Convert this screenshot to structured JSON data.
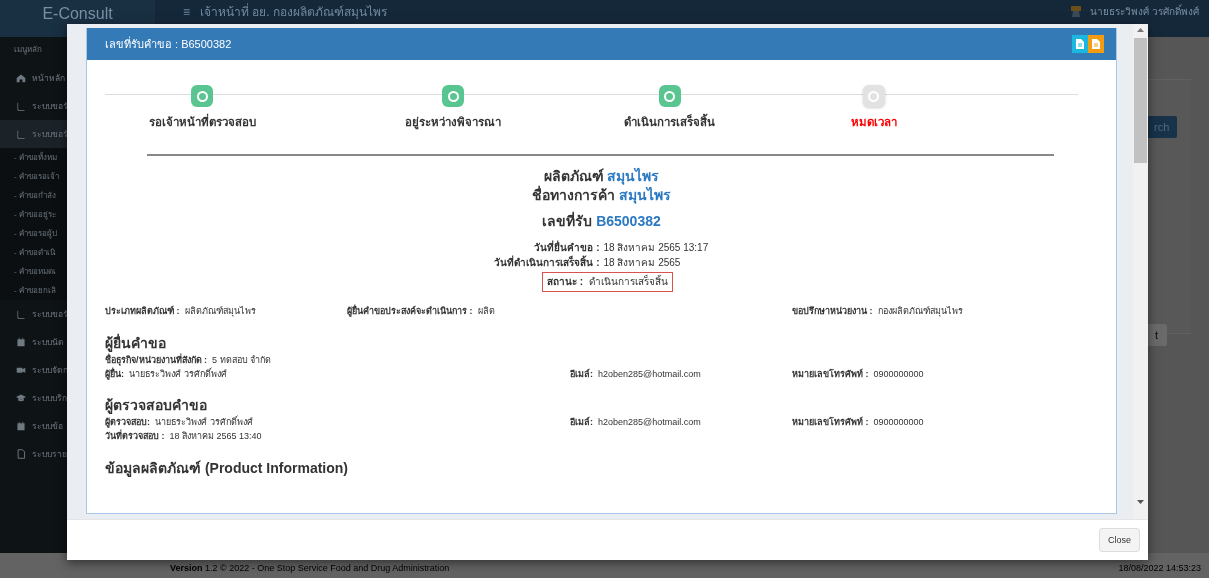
{
  "app": {
    "brand": "E-Consult",
    "menu_icon": "≡",
    "header_title": "เจ้าหน้าที่ อย. กองผลิตภัณฑ์สมุนไพร",
    "user_name": "นายธระวิพงศ์ วรศักดิ์พงศ์"
  },
  "sidebar": {
    "heading": "เมนูหลัก",
    "items": [
      {
        "label": "หน้าหลัก",
        "expanded": false
      },
      {
        "label": "ระบบขอรั",
        "expanded": false
      },
      {
        "label": "ระบบขอรั",
        "expanded": true,
        "children": [
          {
            "label": "- คำขอทั้งหม"
          },
          {
            "label": "- คำขอรอเจ้า"
          },
          {
            "label": "- คำขอกำลัง"
          },
          {
            "label": "- คำขออยู่ระ"
          },
          {
            "label": "- คำขอรอผู้ป"
          },
          {
            "label": "- คำขอดำเนิ"
          },
          {
            "label": "- คำขอหมดเ"
          },
          {
            "label": "- คำขอยกเลิ"
          }
        ]
      },
      {
        "label": "ระบบขอรั",
        "expanded": false
      },
      {
        "label": "ระบบนัด",
        "expanded": false
      },
      {
        "label": "ระบบจัดก",
        "expanded": false
      },
      {
        "label": "ระบบบริก",
        "expanded": false
      },
      {
        "label": "ระบบข้อ",
        "expanded": false
      },
      {
        "label": "ระบบราย",
        "expanded": false
      }
    ]
  },
  "background_panel": {
    "search_button": "rch",
    "button": "t"
  },
  "footer": {
    "version": "**Version** 1.2 © 2022 - One Stop Service Food and Drug Administration",
    "timestamp": "18/08/2022 14:53:23"
  },
  "modal": {
    "title": "เลขที่รับคำขอ : B6500382",
    "steps": [
      {
        "label": "รอเจ้าหน้าที่ตรวจสอบ",
        "kind": "done"
      },
      {
        "label": "อยู่ระหว่างพิจารณา",
        "kind": "done"
      },
      {
        "label": "ดำเนินการเสร็จสิ้น",
        "kind": "done"
      },
      {
        "label": "หมดเวลา",
        "kind": "timeout"
      }
    ],
    "product": {
      "product_label": "ผลิตภัณฑ์",
      "product_value": "สมุนไพร",
      "trade_label": "ชื่อทางการค้า",
      "trade_value": "สมุนไพร",
      "receipt_label": "เลขที่รับ",
      "receipt_value": "B6500382"
    },
    "dates": [
      {
        "label": "วันที่ยื่นคำขอ :",
        "value": "18 สิงหาคม 2565 13:17"
      },
      {
        "label": "วันที่ดำเนินการเสร็จสิ้น :",
        "value": "18 สิงหาคม 2565"
      }
    ],
    "status": {
      "label": "สถานะ :",
      "value": "ดำเนินการเสร็จสิ้น",
      "highlighted": true
    },
    "info": [
      {
        "label": "ประเภทผลิตภัณฑ์ :",
        "value": "ผลิตภัณฑ์สมุนไพร"
      },
      {
        "label": "ผู้ยื่นคำขอประสงค์จะดำเนินการ :",
        "value": "ผลิต"
      },
      {
        "label": "ขอปรึกษาหน่วยงาน :",
        "value": "กองผลิตภัณฑ์สมุนไพร"
      }
    ],
    "sections": [
      {
        "title": "ผู้ยื่นคำขอ",
        "rows": [
          [
            {
              "label": "ชื่อธุรกิจ/หน่วยงานที่สังกัด :",
              "value": "5 ทดสอบ จำกัด"
            }
          ],
          [
            {
              "label": "ผู้ยื่น:",
              "value": "นายธระวิพงศ์ วรศักดิ์พงศ์"
            },
            {
              "label": "อีเมล์:",
              "value": "h2oben285@hotmail.com"
            },
            {
              "label": "หมายเลขโทรศัพท์ :",
              "value": "0900000000"
            }
          ]
        ]
      },
      {
        "title": "ผู้ตรวจสอบคำขอ",
        "rows": [
          [
            {
              "label": "ผู้ตรวจสอบ:",
              "value": "นายธระวิพงศ์ วรศักดิ์พงศ์"
            },
            {
              "label": "อีเมล์:",
              "value": "h2oben285@hotmail.com"
            },
            {
              "label": "หมายเลขโทรศัพท์ :",
              "value": "0900000000"
            }
          ],
          [
            {
              "label": "วันที่ตรวจสอบ :",
              "value": "18 สิงหาคม 2565 13:40"
            }
          ]
        ]
      },
      {
        "title": "ข้อมูลผลิตภัณฑ์ (Product Information)"
      }
    ],
    "close_button": "Close"
  }
}
